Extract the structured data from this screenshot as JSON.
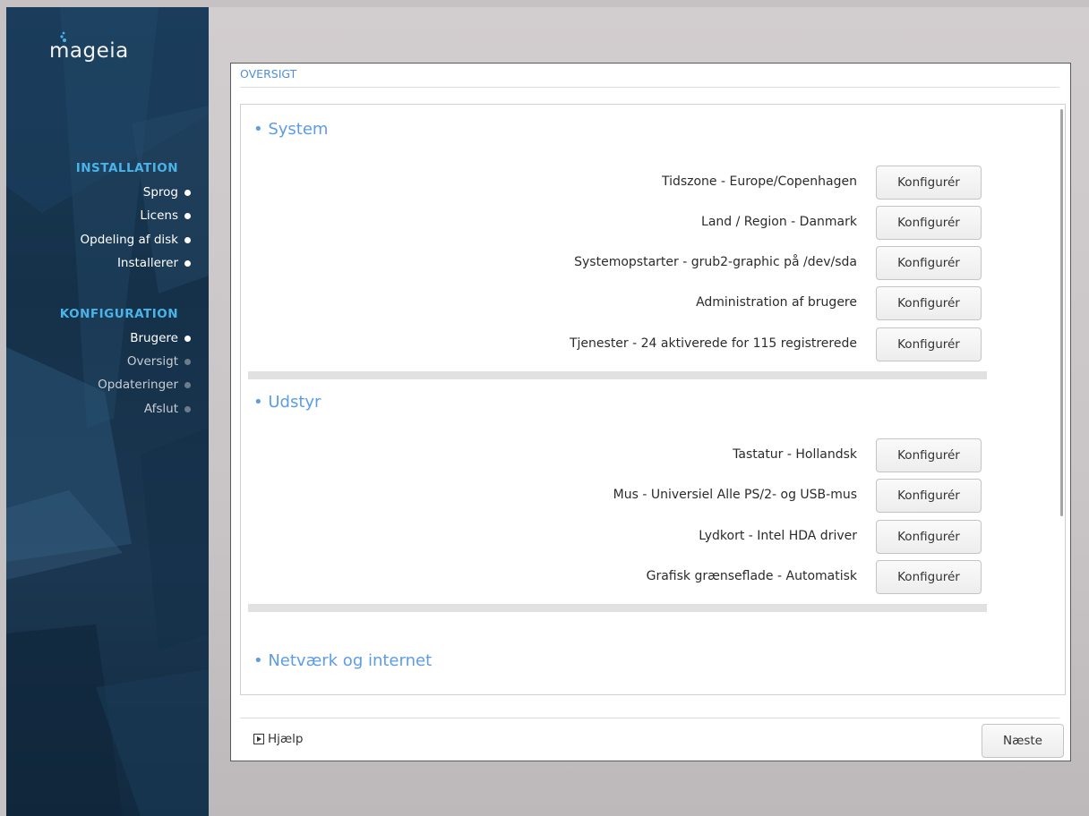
{
  "sidebar": {
    "logo_text": "mageia",
    "installation": {
      "title": "INSTALLATION",
      "steps": [
        {
          "label": "Sprog",
          "state": "done"
        },
        {
          "label": "Licens",
          "state": "done"
        },
        {
          "label": "Opdeling af disk",
          "state": "done"
        },
        {
          "label": "Installerer",
          "state": "done"
        }
      ]
    },
    "configuration": {
      "title": "KONFIGURATION",
      "steps": [
        {
          "label": "Brugere",
          "state": "done"
        },
        {
          "label": "Oversigt",
          "state": "pending"
        },
        {
          "label": "Opdateringer",
          "state": "pending"
        },
        {
          "label": "Afslut",
          "state": "pending"
        }
      ]
    }
  },
  "window": {
    "title": "OVERSIGT",
    "sections": [
      {
        "title": "• System",
        "rows": [
          {
            "label": "Tidszone - Europe/Copenhagen",
            "button": "Konfigurér"
          },
          {
            "label": "Land / Region - Danmark",
            "button": "Konfigurér"
          },
          {
            "label": "Systemopstarter - grub2-graphic på /dev/sda",
            "button": "Konfigurér"
          },
          {
            "label": "Administration af brugere",
            "button": "Konfigurér"
          },
          {
            "label": "Tjenester - 24 aktiverede for 115 registrerede",
            "button": "Konfigurér"
          }
        ]
      },
      {
        "title": "• Udstyr",
        "rows": [
          {
            "label": "Tastatur - Hollandsk",
            "button": "Konfigurér"
          },
          {
            "label": "Mus - Universiel Alle PS/2- og USB-mus",
            "button": "Konfigurér"
          },
          {
            "label": "Lydkort - Intel HDA driver",
            "button": "Konfigurér"
          },
          {
            "label": "Grafisk grænseflade - Automatisk",
            "button": "Konfigurér"
          }
        ]
      },
      {
        "title": "• Netværk og internet",
        "rows": []
      }
    ],
    "help_label": "Hjælp",
    "next_label": "Næste"
  },
  "colors": {
    "accent": "#5d9ce6",
    "sidebar_heading": "#4ab3e8",
    "sidebar_bg": "#17344e"
  }
}
